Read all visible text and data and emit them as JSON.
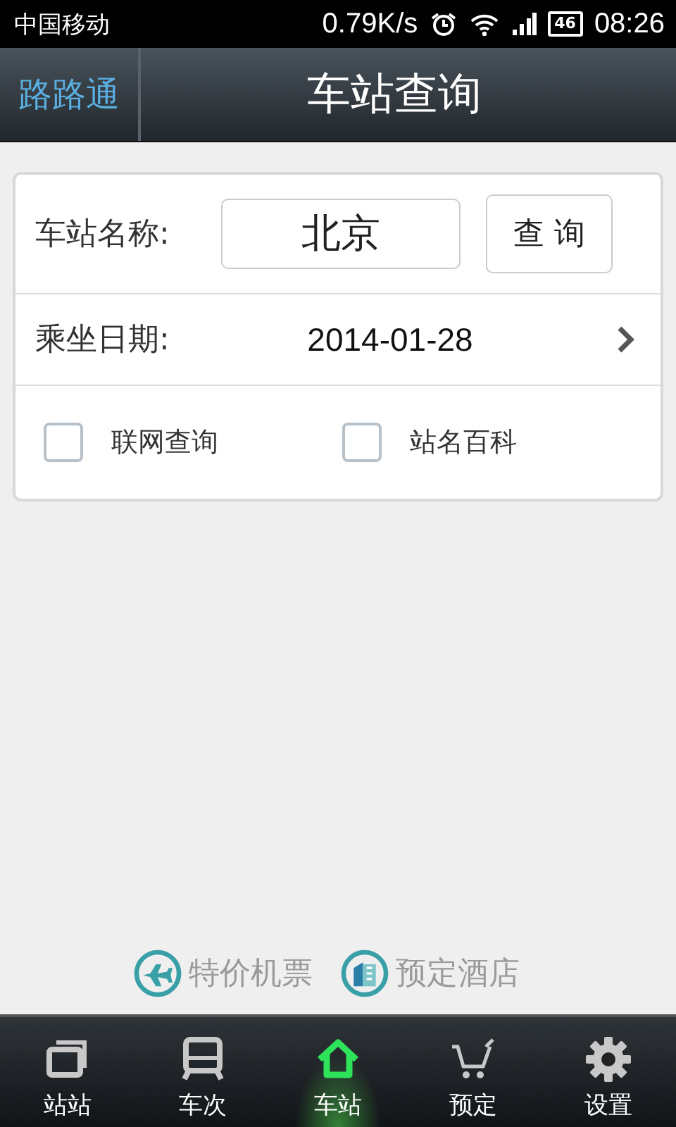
{
  "status_bar": {
    "carrier": "中国移动",
    "speed": "0.79K/s",
    "battery": "46",
    "time": "08:26"
  },
  "header": {
    "back": "路路通",
    "title": "车站查询"
  },
  "form": {
    "station_label": "车站名称:",
    "station_value": "北京",
    "search_button": "查 询",
    "date_label": "乘坐日期:",
    "date_value": "2014-01-28",
    "options": [
      {
        "label": "联网查询",
        "checked": false
      },
      {
        "label": "站名百科",
        "checked": false
      }
    ]
  },
  "links": [
    {
      "kind": "plane",
      "label": "特价机票"
    },
    {
      "kind": "hotel",
      "label": "预定酒店"
    }
  ],
  "tabs": [
    {
      "kind": "windows",
      "label": "站站",
      "selected": false
    },
    {
      "kind": "train",
      "label": "车次",
      "selected": false
    },
    {
      "kind": "home",
      "label": "车站",
      "selected": true
    },
    {
      "kind": "cart",
      "label": "预定",
      "selected": false
    },
    {
      "kind": "gear",
      "label": "设置",
      "selected": false
    }
  ]
}
